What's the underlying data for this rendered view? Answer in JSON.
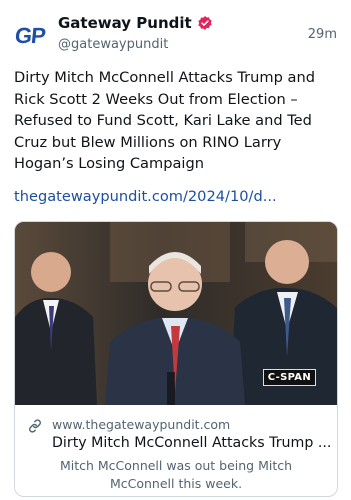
{
  "account": {
    "avatar_text": "GP",
    "name": "Gateway Pundit",
    "handle": "@gatewaypundit",
    "verified": true,
    "time": "29m"
  },
  "post": {
    "text": "Dirty Mitch McConnell Attacks Trump and Rick Scott 2 Weeks Out from Election – Refused to Fund Scott, Kari Lake and Ted Cruz but Blew Millions on RINO Larry Hogan’s Losing Campaign",
    "link": "thegatewaypundit.com/2024/10/d..."
  },
  "card": {
    "image_badge": "C-SPAN",
    "link_icon": "link-icon",
    "domain": "www.thegatewaypundit.com",
    "title": "Dirty Mitch McConnell Attacks Trump ...",
    "description": "Mitch McConnell was out being Mitch McConnell this week."
  },
  "colors": {
    "brand_blue": "#1e4fa8",
    "link_blue": "#1d4fa1",
    "verified_badge": "#e0245e",
    "muted_text": "#536471"
  }
}
